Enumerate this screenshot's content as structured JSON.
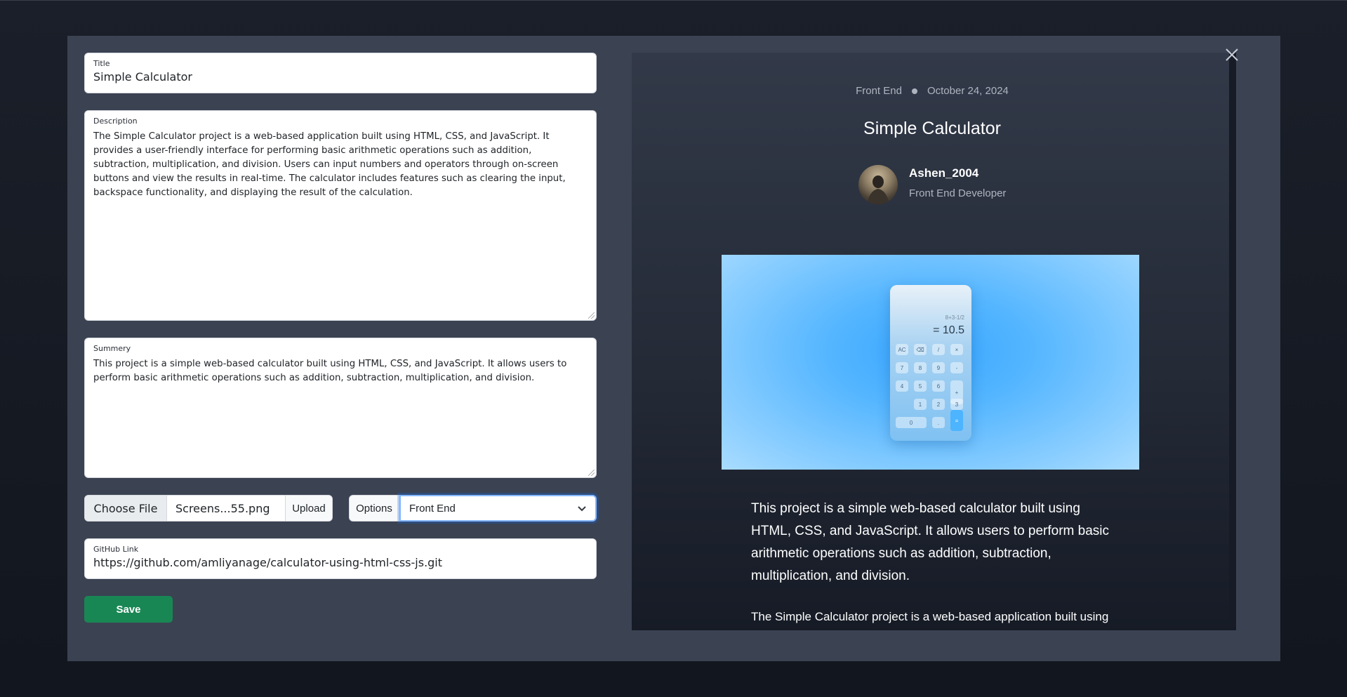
{
  "form": {
    "title_label": "Title",
    "title_value": "Simple Calculator",
    "description_label": "Description",
    "description_value": "The Simple Calculator project is a web-based application built using HTML, CSS, and JavaScript. It provides a user-friendly interface for performing basic arithmetic operations such as addition, subtraction, multiplication, and division. Users can input numbers and operators through on-screen buttons and view the results in real-time. The calculator includes features such as clearing the input, backspace functionality, and displaying the result of the calculation.",
    "summary_label": "Summery",
    "summary_value": "This project is a simple web-based calculator built using HTML, CSS, and JavaScript. It allows users to perform basic arithmetic operations such as addition, subtraction, multiplication, and division.",
    "choose_file_label": "Choose File",
    "file_name": "Screens...55.png",
    "upload_label": "Upload",
    "options_label": "Options",
    "category_selected": "Front End",
    "github_label": "GitHub Link",
    "github_value": "https://github.com/amliyanage/calculator-using-html-css-js.git",
    "save_label": "Save"
  },
  "preview": {
    "category": "Front End",
    "date": "October 24, 2024",
    "title": "Simple Calculator",
    "author_name": "Ashen_2004",
    "author_role": "Front End Developer",
    "summary": "This project is a simple web-based calculator built using HTML, CSS, and JavaScript. It allows users to perform basic arithmetic operations such as addition, subtraction, multiplication, and division.",
    "description_start": "The Simple Calculator project is a web-based application built using",
    "image": {
      "expression": "8+3-1/2",
      "result": "= 10.5",
      "keys": [
        "AC",
        "⌫",
        "/",
        "×",
        "7",
        "8",
        "9",
        "-",
        "4",
        "5",
        "6",
        "+",
        "1",
        "2",
        "3",
        "0",
        ".",
        "="
      ]
    }
  },
  "icons": {
    "close": "close-icon",
    "dropdown": "chevron-down-icon"
  },
  "colors": {
    "modal_bg": "#3b4252",
    "save_button": "#198754",
    "preview_bg": "#242a36"
  }
}
